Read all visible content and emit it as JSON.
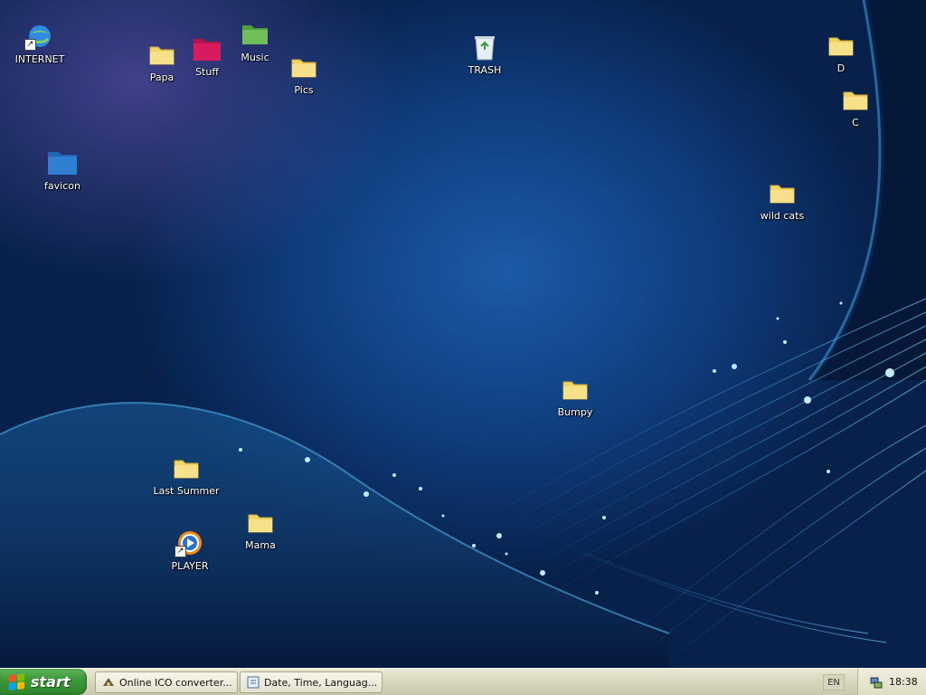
{
  "desktop": {
    "icons": {
      "internet": "INTERNET",
      "papa": "Papa",
      "stuff": "Stuff",
      "music": "Music",
      "pics": "Pics",
      "trash": "TRASH",
      "d": "D",
      "c": "C",
      "favicon": "favicon",
      "wild_cats": "wild cats",
      "bumpy": "Bumpy",
      "last_summer": "Last Summer",
      "mama": "Mama",
      "player": "PLAYER"
    },
    "colors": {
      "folder_yellow": "#f2d466",
      "folder_pink": "#d81b5e",
      "folder_green": "#6fbf5a",
      "folder_blue": "#2f7fd3"
    }
  },
  "taskbar": {
    "start_label": "start",
    "tasks": [
      {
        "label": "Online ICO converter...",
        "icon": "browser-icon"
      },
      {
        "label": "Date, Time, Languag...",
        "icon": "control-panel-icon"
      }
    ],
    "language": "EN",
    "clock": "18:38",
    "colors": {
      "start_green": "#3c9a3a",
      "bar_beige": "#d9d8c0"
    }
  }
}
